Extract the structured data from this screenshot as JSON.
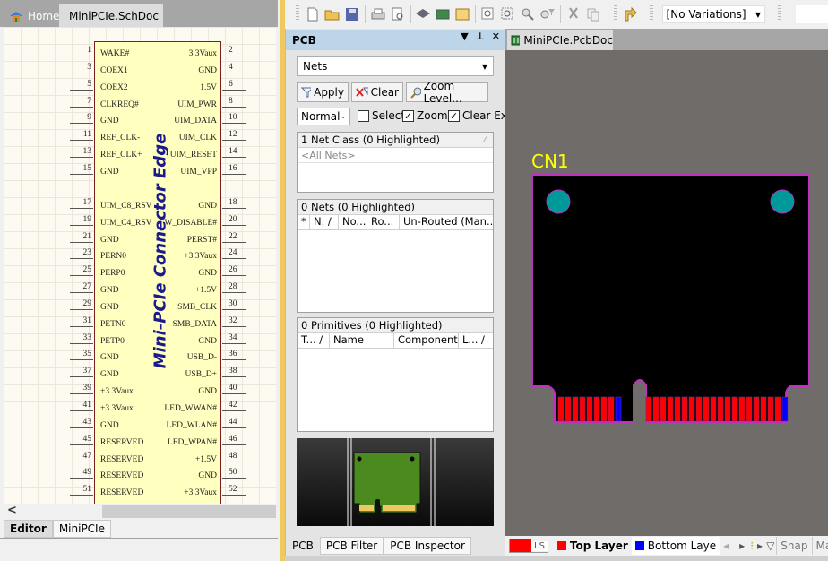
{
  "schematic": {
    "tabs": [
      {
        "label": "Home"
      },
      {
        "label": "MiniPCIe.SchDoc"
      }
    ],
    "component_title": "Mini-PCIe Connector Edge",
    "left_pins": [
      {
        "num": "1",
        "name": "WAKE#"
      },
      {
        "num": "3",
        "name": "COEX1"
      },
      {
        "num": "5",
        "name": "COEX2"
      },
      {
        "num": "7",
        "name": "CLKREQ#"
      },
      {
        "num": "9",
        "name": "GND"
      },
      {
        "num": "11",
        "name": "REF_CLK-"
      },
      {
        "num": "13",
        "name": "REF_CLK+"
      },
      {
        "num": "15",
        "name": "GND"
      },
      {
        "num": "17",
        "name": "UIM_C8_RSV"
      },
      {
        "num": "19",
        "name": "UIM_C4_RSV"
      },
      {
        "num": "21",
        "name": "GND"
      },
      {
        "num": "23",
        "name": "PERN0"
      },
      {
        "num": "25",
        "name": "PERP0"
      },
      {
        "num": "27",
        "name": "GND"
      },
      {
        "num": "29",
        "name": "GND"
      },
      {
        "num": "31",
        "name": "PETN0"
      },
      {
        "num": "33",
        "name": "PETP0"
      },
      {
        "num": "35",
        "name": "GND"
      },
      {
        "num": "37",
        "name": "GND"
      },
      {
        "num": "39",
        "name": "+3.3Vaux"
      },
      {
        "num": "41",
        "name": "+3.3Vaux"
      },
      {
        "num": "43",
        "name": "GND"
      },
      {
        "num": "45",
        "name": "RESERVED"
      },
      {
        "num": "47",
        "name": "RESERVED"
      },
      {
        "num": "49",
        "name": "RESERVED"
      },
      {
        "num": "51",
        "name": "RESERVED"
      }
    ],
    "right_pins": [
      {
        "num": "2",
        "name": "3.3Vaux"
      },
      {
        "num": "4",
        "name": "GND"
      },
      {
        "num": "6",
        "name": "1.5V"
      },
      {
        "num": "8",
        "name": "UIM_PWR"
      },
      {
        "num": "10",
        "name": "UIM_DATA"
      },
      {
        "num": "12",
        "name": "UIM_CLK"
      },
      {
        "num": "14",
        "name": "UIM_RESET"
      },
      {
        "num": "16",
        "name": "UIM_VPP"
      },
      {
        "num": "18",
        "name": "GND"
      },
      {
        "num": "20",
        "name": "W_DISABLE#"
      },
      {
        "num": "22",
        "name": "PERST#"
      },
      {
        "num": "24",
        "name": "+3.3Vaux"
      },
      {
        "num": "26",
        "name": "GND"
      },
      {
        "num": "28",
        "name": "+1.5V"
      },
      {
        "num": "30",
        "name": "SMB_CLK"
      },
      {
        "num": "32",
        "name": "SMB_DATA"
      },
      {
        "num": "34",
        "name": "GND"
      },
      {
        "num": "36",
        "name": "USB_D-"
      },
      {
        "num": "38",
        "name": "USB_D+"
      },
      {
        "num": "40",
        "name": "GND"
      },
      {
        "num": "42",
        "name": "LED_WWAN#"
      },
      {
        "num": "44",
        "name": "LED_WLAN#"
      },
      {
        "num": "46",
        "name": "LED_WPAN#"
      },
      {
        "num": "48",
        "name": "+1.5V"
      },
      {
        "num": "50",
        "name": "GND"
      },
      {
        "num": "52",
        "name": "+3.3Vaux"
      }
    ],
    "bottom_tabs": [
      {
        "label": "Editor"
      },
      {
        "label": "MiniPCIe"
      }
    ]
  },
  "toolbar": {
    "variations": "[No Variations]"
  },
  "pcb_panel": {
    "title": "PCB",
    "mode_select": "Nets",
    "apply_label": "Apply",
    "clear_label": "Clear",
    "zoom_level_label": "Zoom Level...",
    "view_mode": "Normal",
    "checkboxes": [
      {
        "label": "Select",
        "checked": false
      },
      {
        "label": "Zoom",
        "checked": true
      },
      {
        "label": "Clear Exis",
        "checked": true
      }
    ],
    "net_class_header": "1 Net Class (0 Highlighted)",
    "net_class_items": [
      "<All Nets>"
    ],
    "nets_header": "0 Nets (0 Highlighted)",
    "nets_columns": [
      "*",
      "N. /",
      "No...",
      "Ro...",
      "Un-Routed (Man..."
    ],
    "primitives_header": "0 Primitives (0 Highlighted)",
    "primitives_columns": [
      "T... /",
      "Name",
      "Component",
      "L... /"
    ],
    "tabs": [
      {
        "label": "PCB"
      },
      {
        "label": "PCB Filter"
      },
      {
        "label": "PCB Inspector"
      }
    ]
  },
  "pcb_editor": {
    "tab": "MiniPCIe.PcbDoc",
    "designator": "CN1",
    "colors": {
      "board": "#000000",
      "outline": "#c030c0",
      "hole": "#009999",
      "top_pad": "#ff0000",
      "bottom_pad": "#0000ff",
      "designator": "#ffff00"
    }
  },
  "layer_bar": {
    "ls_label": "LS",
    "layers": [
      {
        "name": "Top Layer",
        "color": "#ff0000"
      },
      {
        "name": "Bottom Laye",
        "color": "#0000ff"
      }
    ],
    "snap_label": "Snap",
    "mask_label": "Mask Le"
  }
}
